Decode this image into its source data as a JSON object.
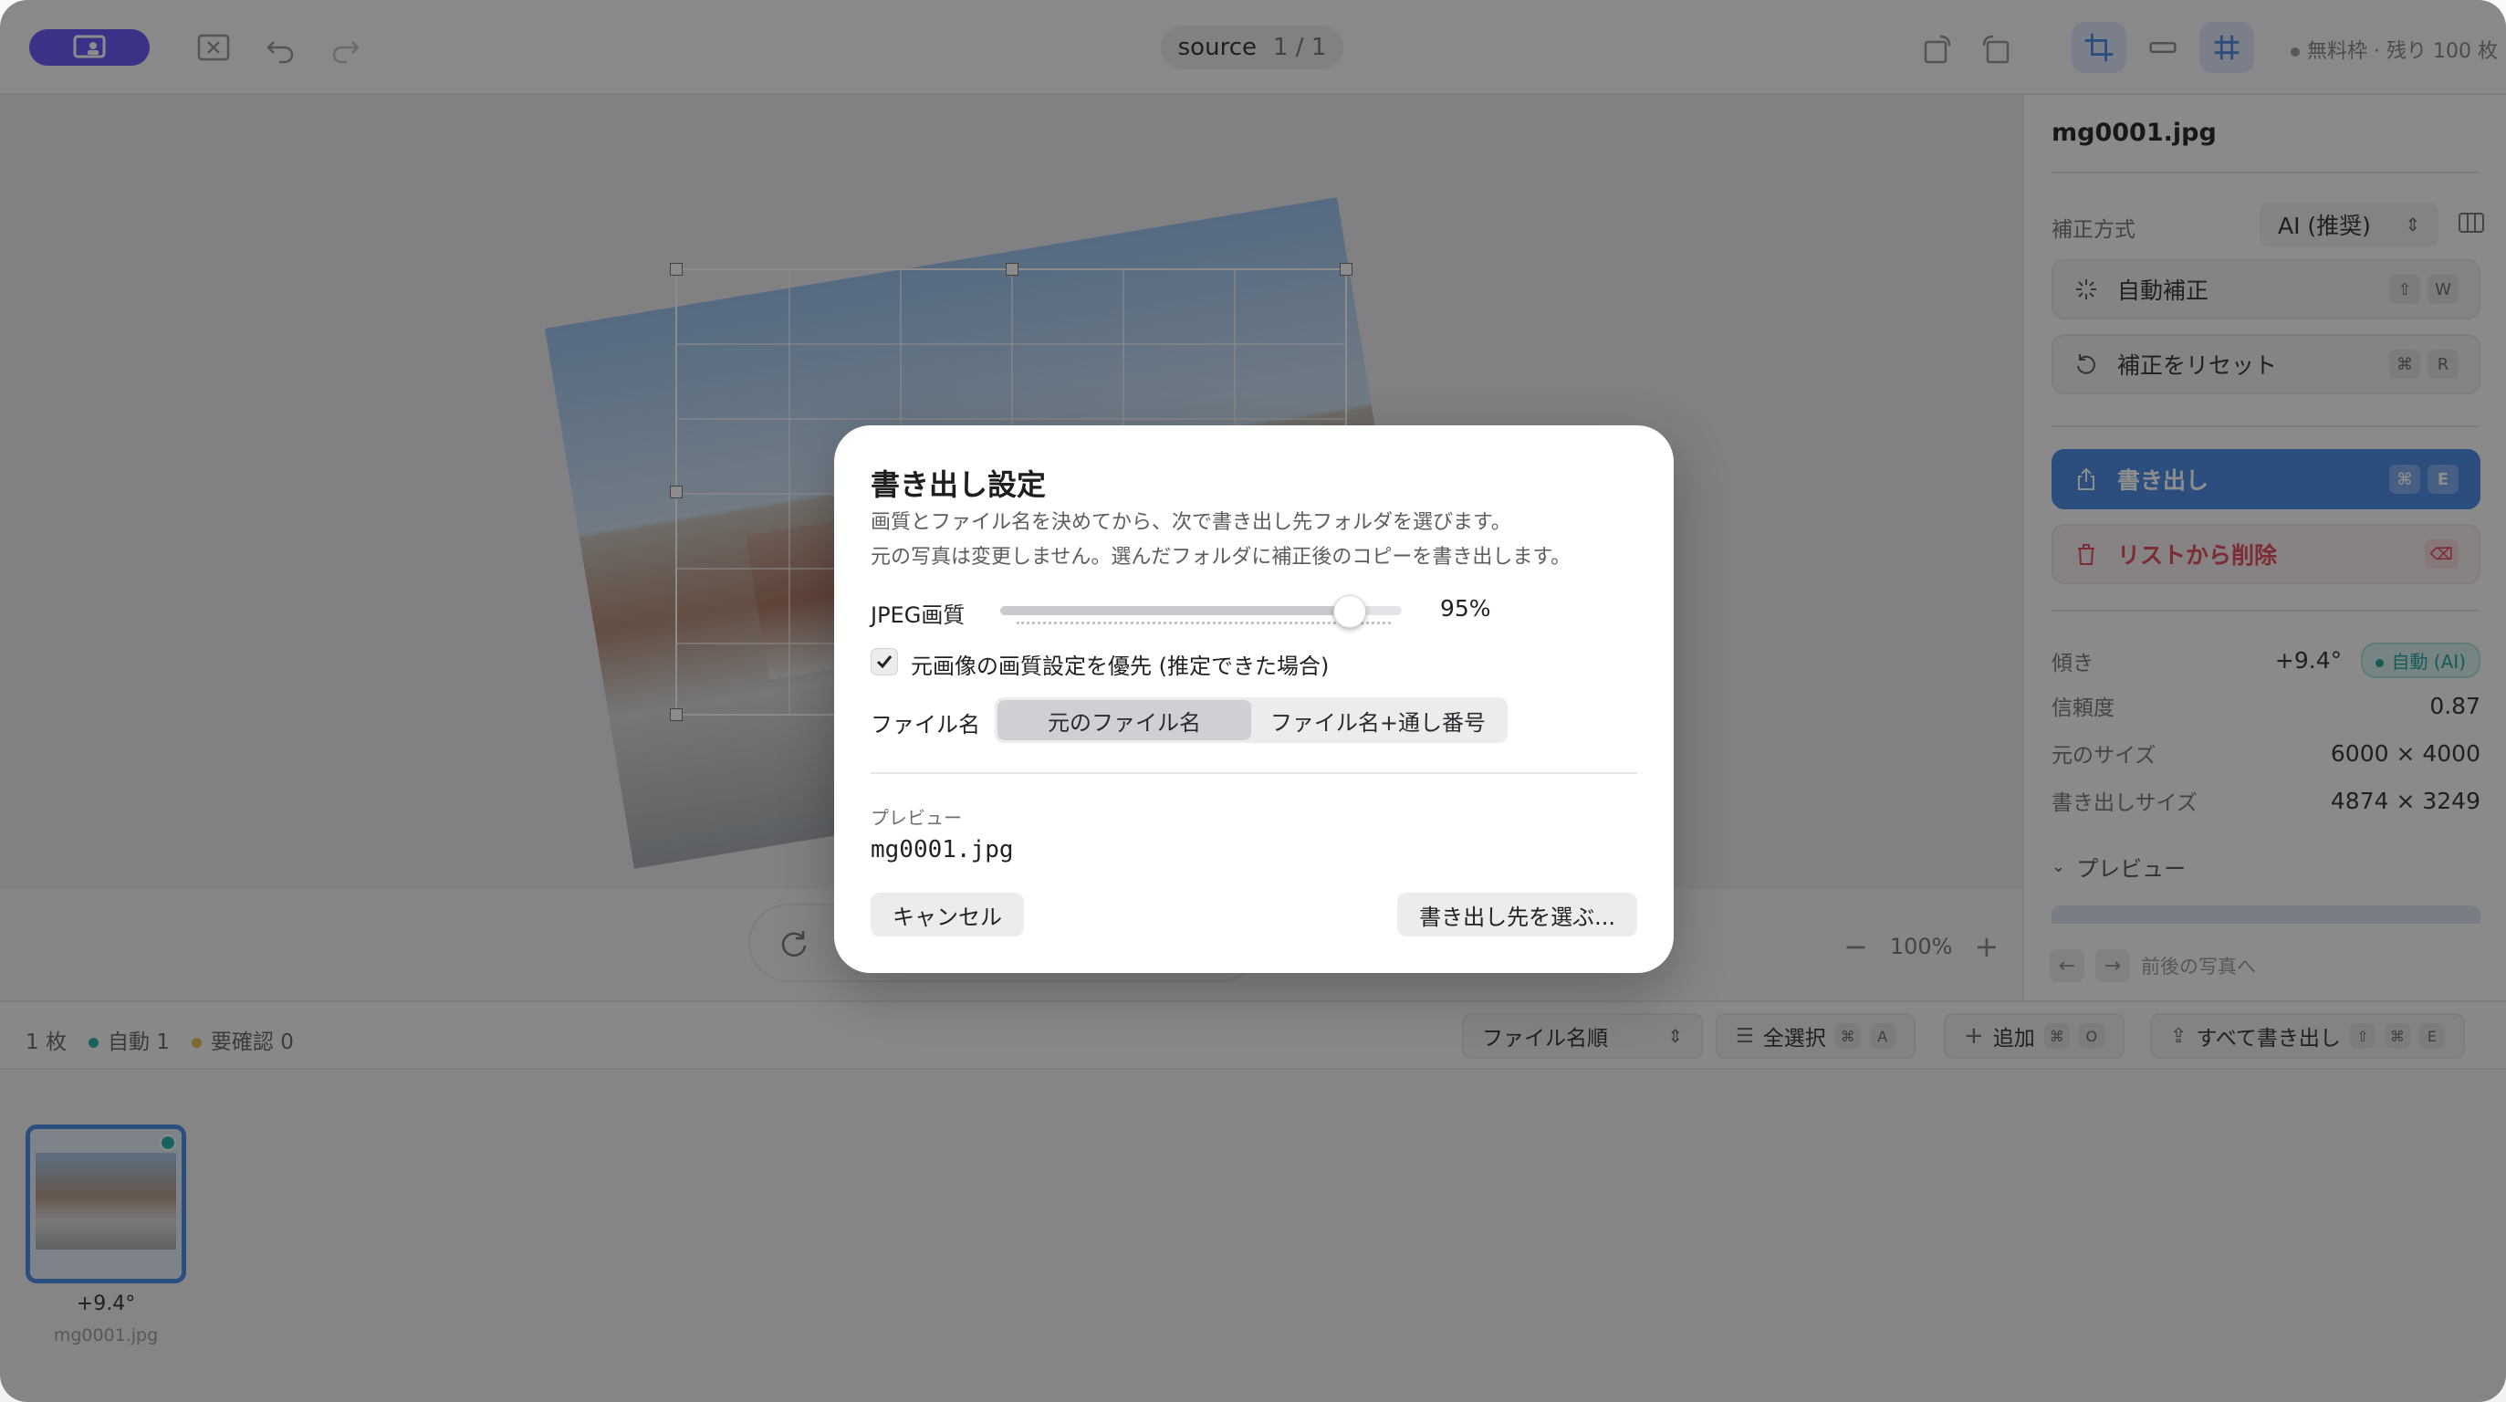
{
  "topbar": {
    "source_label": "source",
    "page_counter": "1 / 1",
    "quota": "無料枠 · 残り 100 枚"
  },
  "sidebar": {
    "filename": "mg0001.jpg",
    "method_label": "補正方式",
    "method_value": "AI (推奨)",
    "auto_button": "自動補正",
    "auto_keys": [
      "⇧",
      "W"
    ],
    "reset_button": "補正をリセット",
    "reset_keys": [
      "⌘",
      "R"
    ],
    "export_button": "書き出し",
    "export_keys": [
      "⌘",
      "E"
    ],
    "remove_button": "リストから削除",
    "rows": [
      {
        "label": "傾き",
        "value": "+9.4°"
      },
      {
        "label": "信頼度",
        "value": "0.87"
      },
      {
        "label": "元のサイズ",
        "value": "6000 × 4000"
      },
      {
        "label": "書き出しサイズ",
        "value": "4874 × 3249"
      }
    ],
    "angle_badge": "自動 (AI)",
    "preview_section": "プレビュー",
    "nav_hint": "前後の写真へ"
  },
  "canvas": {
    "zoom": "100%"
  },
  "bottombar": {
    "count": "1 枚",
    "auto_label": "自動",
    "auto_count": "1",
    "review_label": "要確認",
    "review_count": "0",
    "sort_select": "ファイル名順",
    "select_all": "全選択",
    "select_all_keys": [
      "⌘",
      "A"
    ],
    "add": "追加",
    "add_keys": [
      "⌘",
      "O"
    ],
    "export_all": "すべて書き出し",
    "export_all_keys": [
      "⇧",
      "⌘",
      "E"
    ]
  },
  "filmstrip": {
    "items": [
      {
        "angle": "+9.4°",
        "name": "mg0001.jpg"
      }
    ]
  },
  "dialog": {
    "title": "書き出し設定",
    "desc_line1": "画質とファイル名を決めてから、次で書き出し先フォルダを選びます。",
    "desc_line2": "元の写真は変更しません。選んだフォルダに補正後のコピーを書き出します。",
    "quality_label": "JPEG画質",
    "quality_value": "95%",
    "quality_fraction": 0.87,
    "prefer_source_label": "元画像の画質設定を優先 (推定できた場合)",
    "prefer_source_checked": true,
    "filename_label": "ファイル名",
    "filename_options": [
      "元のファイル名",
      "ファイル名+通し番号"
    ],
    "filename_selected": "元のファイル名",
    "preview_caption": "プレビュー",
    "preview_value": "mg0001.jpg",
    "cancel": "キャンセル",
    "choose_destination": "書き出し先を選ぶ..."
  },
  "colors": {
    "accent": "#4f8fe8",
    "brand": "#6b5cf6",
    "danger": "#e2505e",
    "auto_status": "#2aa7a0"
  }
}
